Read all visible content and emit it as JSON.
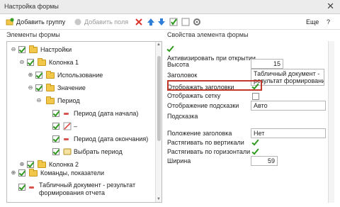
{
  "window": {
    "title": "Настройка формы"
  },
  "toolbar": {
    "add_group": "Добавить группу",
    "add_fields": "Добавить поля",
    "more": "Еще",
    "help": "?"
  },
  "left": {
    "title": "Элементы формы",
    "tree": [
      {
        "label": "Настройки"
      },
      {
        "label": "Колонка 1"
      },
      {
        "label": "Использование"
      },
      {
        "label": "Значение"
      },
      {
        "label": "Период"
      },
      {
        "label": "Период (дата начала)"
      },
      {
        "label": "–"
      },
      {
        "label": "Период (дата окончания)"
      },
      {
        "label": "Выбрать период"
      },
      {
        "label": "Колонка 2"
      },
      {
        "label": "Команды, показатели"
      },
      {
        "label": "Табличный документ - результат",
        "label2": "формирования отчета"
      }
    ]
  },
  "right": {
    "title": "Свойства элемента формы",
    "props": [
      {
        "label": "Активизировать при открытии"
      },
      {
        "label": "Высота",
        "value": "15"
      },
      {
        "label": "Заголовок",
        "value": "Табличный документ -",
        "value2": "результат формирования"
      },
      {
        "label": "Отображать заголовки"
      },
      {
        "label": "Отображать сетку"
      },
      {
        "label": "Отображение подсказки",
        "value": "Авто"
      },
      {
        "label": "Подсказка"
      },
      {
        "label": "Положение заголовка",
        "value": "Нет"
      },
      {
        "label": "Растягивать по вертикали"
      },
      {
        "label": "Растягивать по горизонтали"
      },
      {
        "label": "Ширина",
        "value": "59"
      }
    ]
  },
  "colors": {
    "accent": "#c0392b",
    "highlight": "#fbe68a",
    "check": "#2f9a1f"
  }
}
